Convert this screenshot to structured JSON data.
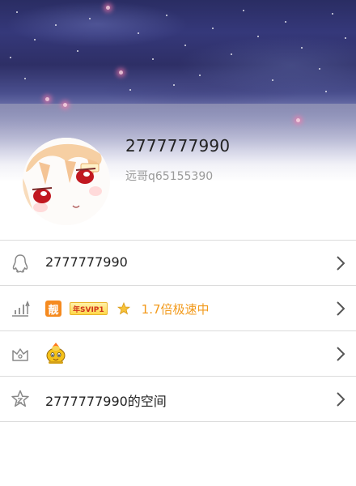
{
  "profile": {
    "username": "2777777990",
    "nickname": "远哥q65155390"
  },
  "list": {
    "account": {
      "text": "2777777990"
    },
    "vip": {
      "liang_badge": "靓",
      "svip_badge": "年SVIP1",
      "speed_text": "1.7倍极速中"
    },
    "space": {
      "text": "2777777990的空间"
    }
  },
  "icons": {
    "account": "qq-penguin-icon",
    "vip": "level-chart-icon",
    "pet": "crown-box-icon",
    "space": "star-icon",
    "pet_badge": "yellow-pet-icon",
    "chevron": "chevron-right-icon"
  },
  "colors": {
    "accent_orange": "#f29a1c",
    "liang_badge_bg": "#f58a1f",
    "svip_badge_bg": "#ffd84a",
    "divider": "#dcdcdc"
  }
}
